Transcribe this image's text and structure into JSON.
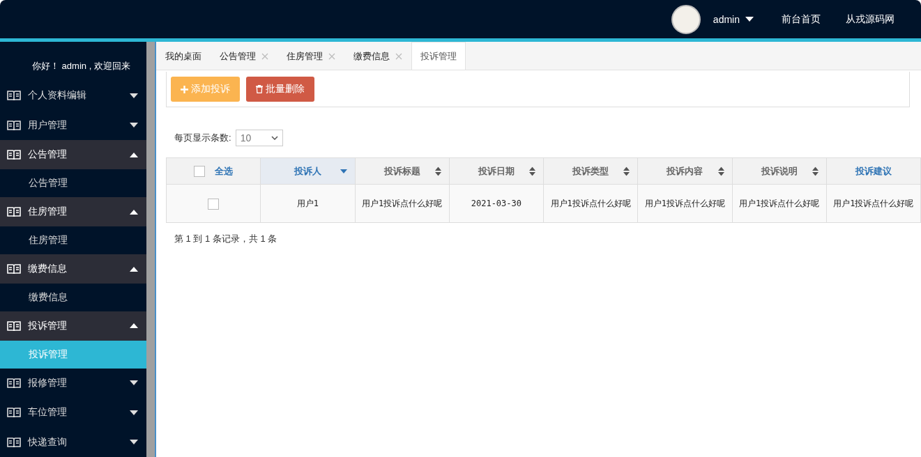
{
  "header": {
    "user": "admin",
    "links": [
      "前台首页",
      "从戎源码网"
    ]
  },
  "sidebar": {
    "welcome": "你好！ admin , 欢迎回来",
    "items": [
      {
        "label": "个人资料编辑",
        "expanded": false
      },
      {
        "label": "用户管理",
        "expanded": false
      },
      {
        "label": "公告管理",
        "expanded": true,
        "children": [
          {
            "label": "公告管理",
            "selected": false
          }
        ]
      },
      {
        "label": "住房管理",
        "expanded": true,
        "children": [
          {
            "label": "住房管理",
            "selected": false
          }
        ]
      },
      {
        "label": "缴费信息",
        "expanded": true,
        "children": [
          {
            "label": "缴费信息",
            "selected": false
          }
        ]
      },
      {
        "label": "投诉管理",
        "expanded": true,
        "children": [
          {
            "label": "投诉管理",
            "selected": true
          }
        ]
      },
      {
        "label": "报修管理",
        "expanded": false
      },
      {
        "label": "车位管理",
        "expanded": false
      },
      {
        "label": "快递查询",
        "expanded": false
      }
    ]
  },
  "tabs": [
    {
      "label": "我的桌面",
      "selected": false,
      "closable": false
    },
    {
      "label": "公告管理",
      "selected": false,
      "closable": true
    },
    {
      "label": "住房管理",
      "selected": false,
      "closable": true
    },
    {
      "label": "缴费信息",
      "selected": false,
      "closable": true
    },
    {
      "label": "投诉管理",
      "selected": true,
      "closable": false
    }
  ],
  "toolbar": {
    "buttons": [
      {
        "label": "添加投诉",
        "kind": "add"
      },
      {
        "label": "批量删除",
        "kind": "delete"
      }
    ]
  },
  "page_size": {
    "label": "每页显示条数:",
    "value": "10"
  },
  "table": {
    "select_all": {
      "label": "全选",
      "checked": false
    },
    "columns": [
      {
        "label": "投诉人",
        "sortable": true,
        "sorted": true
      },
      {
        "label": "投诉标题",
        "sortable": true,
        "sorted": false
      },
      {
        "label": "投诉日期",
        "sortable": true,
        "sorted": false
      },
      {
        "label": "投诉类型",
        "sortable": true,
        "sorted": false
      },
      {
        "label": "投诉内容",
        "sortable": true,
        "sorted": false
      },
      {
        "label": "投诉说明",
        "sortable": true,
        "sorted": false
      },
      {
        "label": "投诉建议",
        "sortable": false,
        "sorted": false
      }
    ],
    "rows": [
      {
        "checked": false,
        "cells": [
          "用户1",
          "用户1投诉点什么好呢",
          "2021-03-30",
          "用户1投诉点什么好呢",
          "用户1投诉点什么好呢",
          "用户1投诉点什么好呢",
          "用户1投诉点什么好呢"
        ]
      }
    ]
  },
  "pagination": "第 1 到 1 条记录，共 1 条"
}
